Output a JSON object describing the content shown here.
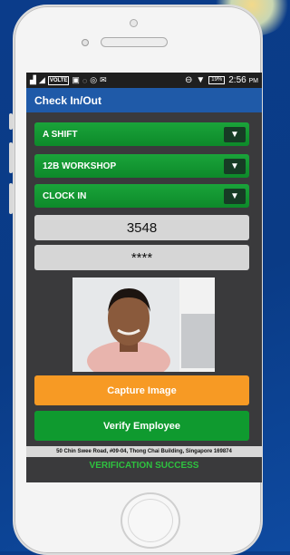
{
  "statusbar": {
    "carrier": "LTE",
    "time": "2:56",
    "ampm": "PM",
    "battery": "19%"
  },
  "appbar": {
    "title": "Check In/Out"
  },
  "dropdowns": [
    {
      "value": "A SHIFT"
    },
    {
      "value": "12B WORKSHOP"
    },
    {
      "value": "CLOCK IN"
    }
  ],
  "fields": {
    "employee_id": "3548",
    "pin": "****"
  },
  "buttons": {
    "capture": "Capture Image",
    "verify": "Verify Employee"
  },
  "footer": {
    "address": "50 Chin Swee Road, #09-04, Thong Chai Building, Singapore 169874",
    "status": "VERIFICATION SUCCESS"
  },
  "colors": {
    "appbar": "#1f5aa8",
    "dropdown": "#12962f",
    "capture": "#f79a24",
    "verify": "#0f9a2f",
    "success": "#2ec23f"
  }
}
